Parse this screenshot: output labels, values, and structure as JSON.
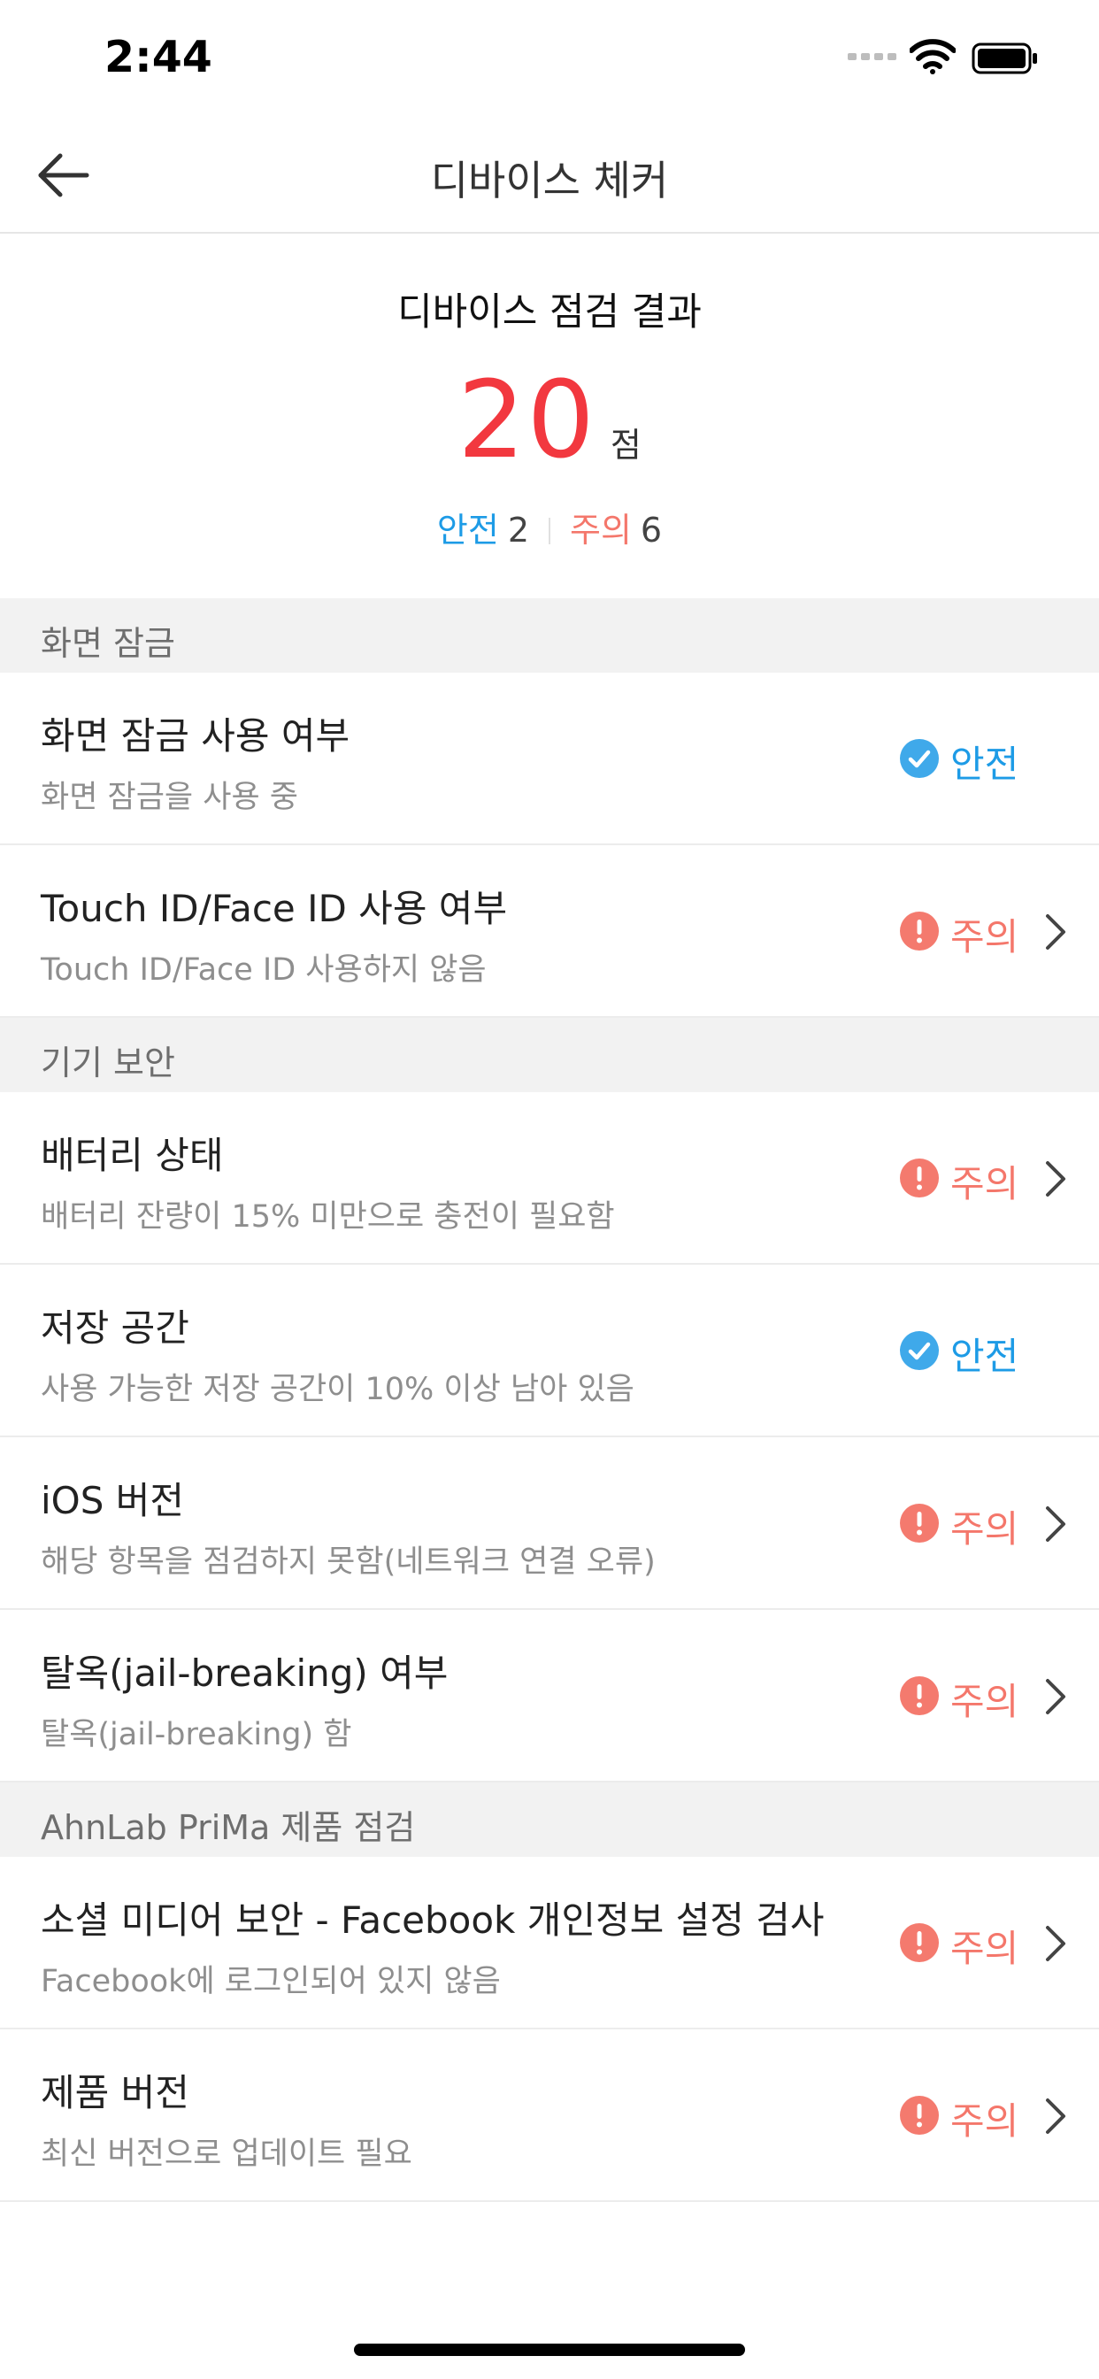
{
  "status_bar": {
    "time": "2:44"
  },
  "nav": {
    "title": "디바이스 체커"
  },
  "summary": {
    "title": "디바이스 점검 결과",
    "score": "20",
    "score_unit": "점",
    "safe_label": "안전",
    "safe_count": "2",
    "warn_label": "주의",
    "warn_count": "6"
  },
  "sections": [
    {
      "header": "화면 잠금",
      "items": [
        {
          "title": "화면 잠금 사용 여부",
          "subtitle": "화면 잠금을 사용 중",
          "status": "안전"
        },
        {
          "title": "Touch ID/Face ID 사용 여부",
          "subtitle": "Touch ID/Face ID 사용하지 않음",
          "status": "주의"
        }
      ]
    },
    {
      "header": "기기 보안",
      "items": [
        {
          "title": "배터리 상태",
          "subtitle": "배터리 잔량이 15% 미만으로 충전이 필요함",
          "status": "주의"
        },
        {
          "title": "저장 공간",
          "subtitle": "사용 가능한 저장 공간이 10% 이상 남아 있음",
          "status": "안전"
        },
        {
          "title": "iOS 버전",
          "subtitle": "해당 항목을 점검하지 못함(네트워크 연결 오류)",
          "status": "주의"
        },
        {
          "title": "탈옥(jail-breaking) 여부",
          "subtitle": "탈옥(jail-breaking) 함",
          "status": "주의"
        }
      ]
    },
    {
      "header": "AhnLab PriMa 제품 점검",
      "items": [
        {
          "title": "소셜 미디어 보안 - Facebook 개인정보 설정 검사",
          "subtitle": "Facebook에 로그인되어 있지 않음",
          "status": "주의"
        },
        {
          "title": "제품 버전",
          "subtitle": "최신 버전으로 업데이트 필요",
          "status": "주의"
        }
      ]
    }
  ],
  "colors": {
    "safe": "#1d9be6",
    "warn": "#f4776b",
    "score": "#f2383f"
  },
  "icons": {
    "safe": "check-circle-icon",
    "warn": "exclamation-circle-icon",
    "back": "arrow-left-icon",
    "chevron": "chevron-right-icon"
  }
}
